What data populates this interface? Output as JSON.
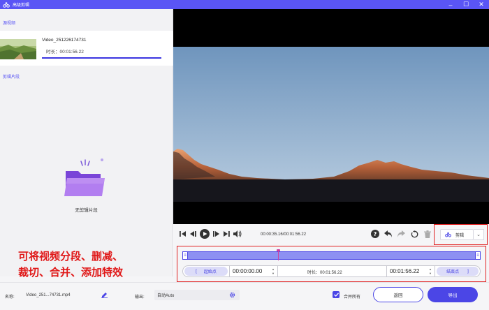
{
  "window": {
    "title": "高级剪辑"
  },
  "left_panel": {
    "source_label": "源视频",
    "video": {
      "name": "Video_251226174731",
      "duration": "时长：00:01:56.22"
    },
    "clips_label": "剪辑片段",
    "empty_text": "无剪辑片段"
  },
  "player": {
    "timecode": "00:00:35.16/00:01:56.22",
    "cut_label": "剪辑"
  },
  "timeline": {
    "start_button": "起始点",
    "start_time": "00:00:00.00",
    "duration_label": "时长：00:01:56.22",
    "end_time": "00:01:56.22",
    "end_button": "结束点"
  },
  "annotation": {
    "line1": "可将视频分段、删减、",
    "line2": "裁切、合并、添加特效"
  },
  "bottom": {
    "name_label": "名称:",
    "name_value": "Video_251...74731.mp4",
    "output_label": "输出:",
    "output_value": "自动Auto",
    "merge_label": "合并所有",
    "merge_checked": true,
    "return_label": "返回",
    "export_label": "导出"
  },
  "colors": {
    "accent": "#4b46e6",
    "titlebar": "#5a55f5",
    "annotation": "#e01818"
  }
}
